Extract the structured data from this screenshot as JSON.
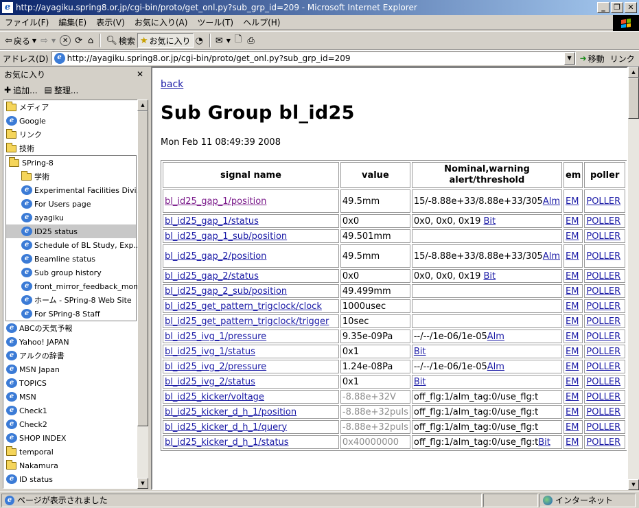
{
  "window": {
    "title": "http://ayagiku.spring8.or.jp/cgi-bin/proto/get_onl.py?sub_grp_id=209 - Microsoft Internet Explorer"
  },
  "menu": [
    "ファイル(F)",
    "編集(E)",
    "表示(V)",
    "お気に入り(A)",
    "ツール(T)",
    "ヘルプ(H)"
  ],
  "toolbar": {
    "back": "戻る",
    "search": "検索",
    "favorites": "お気に入り"
  },
  "address": {
    "label": "アドレス(D)",
    "url": "http://ayagiku.spring8.or.jp/cgi-bin/proto/get_onl.py?sub_grp_id=209",
    "go": "移動",
    "links": "リンク"
  },
  "favorites": {
    "title": "お気に入り",
    "add": "追加...",
    "organize": "整理...",
    "top": [
      {
        "type": "folder",
        "label": "メディア"
      },
      {
        "type": "page",
        "label": "Google"
      },
      {
        "type": "folder",
        "label": "リンク"
      },
      {
        "type": "folder",
        "label": "技術"
      }
    ],
    "group": {
      "label": "SPring-8",
      "items": [
        {
          "type": "folder",
          "label": "学術"
        },
        {
          "type": "page",
          "label": "Experimental Facilities Divi..."
        },
        {
          "type": "page",
          "label": "For Users page"
        },
        {
          "type": "page",
          "label": "ayagiku"
        },
        {
          "type": "page",
          "label": "ID25 status",
          "selected": true
        },
        {
          "type": "page",
          "label": "Schedule of BL Study, Exp..."
        },
        {
          "type": "page",
          "label": "Beamline status"
        },
        {
          "type": "page",
          "label": "Sub group history"
        },
        {
          "type": "page",
          "label": "front_mirror_feedback_monit..."
        },
        {
          "type": "page",
          "label": "ホーム - SPring-8 Web Site"
        },
        {
          "type": "page",
          "label": "For SPring-8 Staff"
        }
      ]
    },
    "bottom": [
      {
        "type": "page",
        "label": "ABCの天気予報"
      },
      {
        "type": "page",
        "label": "Yahoo! JAPAN"
      },
      {
        "type": "page",
        "label": "アルクの辞書"
      },
      {
        "type": "page",
        "label": "MSN Japan"
      },
      {
        "type": "page",
        "label": "TOPICS"
      },
      {
        "type": "page",
        "label": "MSN"
      },
      {
        "type": "page",
        "label": "Check1"
      },
      {
        "type": "page",
        "label": "Check2"
      },
      {
        "type": "page",
        "label": "SHOP INDEX"
      },
      {
        "type": "folder",
        "label": "temporal"
      },
      {
        "type": "folder",
        "label": "Nakamura"
      },
      {
        "type": "page",
        "label": "ID status"
      }
    ]
  },
  "page": {
    "back": "back",
    "title": "Sub Group bl_id25",
    "timestamp": "Mon Feb 11 08:49:39 2008",
    "headers": [
      "signal name",
      "value",
      "Nominal,warning alert/threshold",
      "em",
      "poller"
    ],
    "rows": [
      {
        "name": "bl_id25_gap_1/position",
        "visited": true,
        "value": "49.5mm",
        "nominal": "15/-8.88e+33/8.88e+33/305",
        "alm": "Alm",
        "tall": true
      },
      {
        "name": "bl_id25_gap_1/status",
        "value": "0x0",
        "nominal": "0x0, 0x0, 0x19 ",
        "alm": "Bit"
      },
      {
        "name": "bl_id25_gap_1_sub/position",
        "value": "49.501mm",
        "nominal": "",
        "alm": ""
      },
      {
        "name": "bl_id25_gap_2/position",
        "value": "49.5mm",
        "nominal": "15/-8.88e+33/8.88e+33/305",
        "alm": "Alm",
        "tall": true
      },
      {
        "name": "bl_id25_gap_2/status",
        "value": "0x0",
        "nominal": "0x0, 0x0, 0x19 ",
        "alm": "Bit"
      },
      {
        "name": "bl_id25_gap_2_sub/position",
        "value": "49.499mm",
        "nominal": "",
        "alm": ""
      },
      {
        "name": "bl_id25_get_pattern_trigclock/clock",
        "value": "1000usec",
        "nominal": "",
        "alm": ""
      },
      {
        "name": "bl_id25_get_pattern_trigclock/trigger",
        "value": "10sec",
        "nominal": "",
        "alm": ""
      },
      {
        "name": "bl_id25_ivg_1/pressure",
        "value": "9.35e-09Pa",
        "nominal": "--/--/1e-06/1e-05",
        "alm": "Alm"
      },
      {
        "name": "bl_id25_ivg_1/status",
        "value": "0x1",
        "nominal": "",
        "alm": "Bit"
      },
      {
        "name": "bl_id25_ivg_2/pressure",
        "value": "1.24e-08Pa",
        "nominal": "--/--/1e-06/1e-05",
        "alm": "Alm"
      },
      {
        "name": "bl_id25_ivg_2/status",
        "value": "0x1",
        "nominal": "",
        "alm": "Bit"
      },
      {
        "name": "bl_id25_kicker/voltage",
        "value": "-8.88e+32V",
        "grey": true,
        "nominal": "off_flg:1/alm_tag:0/use_flg:t",
        "alm": ""
      },
      {
        "name": "bl_id25_kicker_d_h_1/position",
        "value": "-8.88e+32puls",
        "grey": true,
        "nominal": "off_flg:1/alm_tag:0/use_flg:t",
        "alm": ""
      },
      {
        "name": "bl_id25_kicker_d_h_1/query",
        "value": "-8.88e+32puls",
        "grey": true,
        "nominal": "off_flg:1/alm_tag:0/use_flg:t",
        "alm": ""
      },
      {
        "name": "bl_id25_kicker_d_h_1/status",
        "value": "0x40000000",
        "grey": true,
        "nominal": "off_flg:1/alm_tag:0/use_flg:t",
        "alm": "Bit"
      }
    ],
    "em_label": "EM",
    "poller_label": "POLLER"
  },
  "status": {
    "text": "ページが表示されました",
    "zone": "インターネット"
  }
}
